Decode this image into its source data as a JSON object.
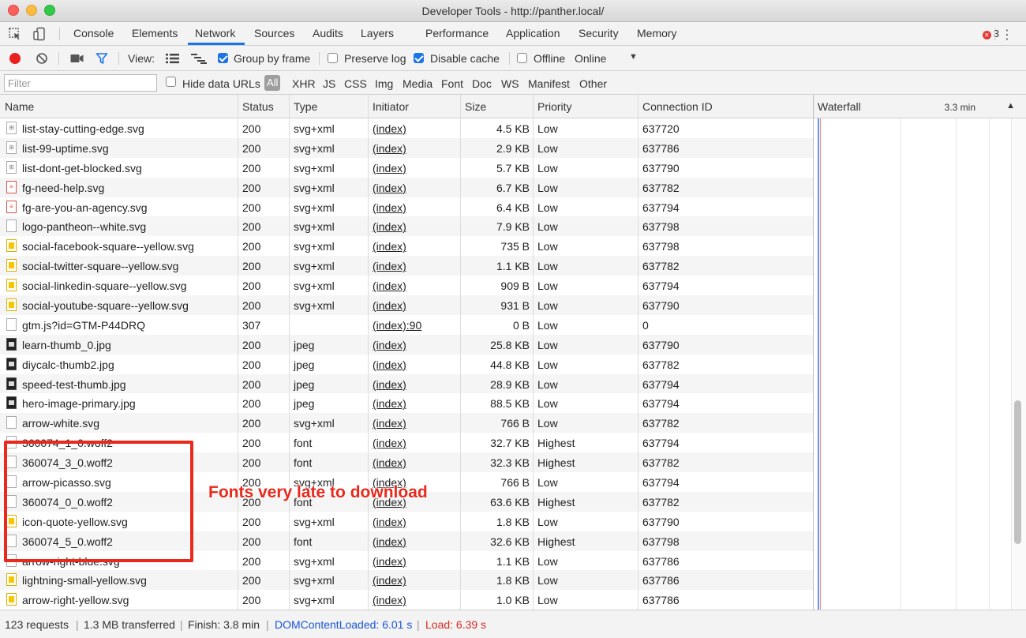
{
  "window": {
    "title": "Developer Tools - http://panther.local/"
  },
  "tabs": [
    {
      "label": "Console"
    },
    {
      "label": "Elements"
    },
    {
      "label": "Network"
    },
    {
      "label": "Sources"
    },
    {
      "label": "Audits"
    },
    {
      "label": "Layers"
    },
    {
      "label": "Performance"
    },
    {
      "label": "Application"
    },
    {
      "label": "Security"
    },
    {
      "label": "Memory"
    }
  ],
  "error_count": "3",
  "toolbar": {
    "view_label": "View:",
    "group_by_frame": "Group by frame",
    "preserve_log": "Preserve log",
    "disable_cache": "Disable cache",
    "offline": "Offline",
    "throttle": "Online"
  },
  "filterbar": {
    "filter_placeholder": "Filter",
    "hide_data_urls": "Hide data URLs",
    "all": "All",
    "types": [
      "XHR",
      "JS",
      "CSS",
      "Img",
      "Media",
      "Font",
      "Doc",
      "WS",
      "Manifest",
      "Other"
    ]
  },
  "columns": {
    "name": "Name",
    "status": "Status",
    "type": "Type",
    "initiator": "Initiator",
    "size": "Size",
    "priority": "Priority",
    "connection": "Connection ID",
    "waterfall": "Waterfall",
    "waterfall_time": "3.3 min"
  },
  "rows": [
    {
      "name": "list-stay-cutting-edge.svg",
      "status": "200",
      "type": "svg+xml",
      "initiator": "(index)",
      "size": "4.5 KB",
      "priority": "Low",
      "conn": "637720",
      "icon": "svg"
    },
    {
      "name": "list-99-uptime.svg",
      "status": "200",
      "type": "svg+xml",
      "initiator": "(index)",
      "size": "2.9 KB",
      "priority": "Low",
      "conn": "637786",
      "icon": "svg"
    },
    {
      "name": "list-dont-get-blocked.svg",
      "status": "200",
      "type": "svg+xml",
      "initiator": "(index)",
      "size": "5.7 KB",
      "priority": "Low",
      "conn": "637790",
      "icon": "svg"
    },
    {
      "name": "fg-need-help.svg",
      "status": "200",
      "type": "svg+xml",
      "initiator": "(index)",
      "size": "6.7 KB",
      "priority": "Low",
      "conn": "637782",
      "icon": "red"
    },
    {
      "name": "fg-are-you-an-agency.svg",
      "status": "200",
      "type": "svg+xml",
      "initiator": "(index)",
      "size": "6.4 KB",
      "priority": "Low",
      "conn": "637794",
      "icon": "red"
    },
    {
      "name": "logo-pantheon--white.svg",
      "status": "200",
      "type": "svg+xml",
      "initiator": "(index)",
      "size": "7.9 KB",
      "priority": "Low",
      "conn": "637798",
      "icon": "blank"
    },
    {
      "name": "social-facebook-square--yellow.svg",
      "status": "200",
      "type": "svg+xml",
      "initiator": "(index)",
      "size": "735 B",
      "priority": "Low",
      "conn": "637798",
      "icon": "yel"
    },
    {
      "name": "social-twitter-square--yellow.svg",
      "status": "200",
      "type": "svg+xml",
      "initiator": "(index)",
      "size": "1.1 KB",
      "priority": "Low",
      "conn": "637782",
      "icon": "yel"
    },
    {
      "name": "social-linkedin-square--yellow.svg",
      "status": "200",
      "type": "svg+xml",
      "initiator": "(index)",
      "size": "909 B",
      "priority": "Low",
      "conn": "637794",
      "icon": "yel"
    },
    {
      "name": "social-youtube-square--yellow.svg",
      "status": "200",
      "type": "svg+xml",
      "initiator": "(index)",
      "size": "931 B",
      "priority": "Low",
      "conn": "637790",
      "icon": "yel"
    },
    {
      "name": "gtm.js?id=GTM-P44DRQ",
      "status": "307",
      "type": "",
      "initiator": "(index):90",
      "size": "0 B",
      "priority": "Low",
      "conn": "0",
      "icon": "blank"
    },
    {
      "name": "learn-thumb_0.jpg",
      "status": "200",
      "type": "jpeg",
      "initiator": "(index)",
      "size": "25.8 KB",
      "priority": "Low",
      "conn": "637790",
      "icon": "img"
    },
    {
      "name": "diycalc-thumb2.jpg",
      "status": "200",
      "type": "jpeg",
      "initiator": "(index)",
      "size": "44.8 KB",
      "priority": "Low",
      "conn": "637782",
      "icon": "img"
    },
    {
      "name": "speed-test-thumb.jpg",
      "status": "200",
      "type": "jpeg",
      "initiator": "(index)",
      "size": "28.9 KB",
      "priority": "Low",
      "conn": "637794",
      "icon": "img"
    },
    {
      "name": "hero-image-primary.jpg",
      "status": "200",
      "type": "jpeg",
      "initiator": "(index)",
      "size": "88.5 KB",
      "priority": "Low",
      "conn": "637794",
      "icon": "img"
    },
    {
      "name": "arrow-white.svg",
      "status": "200",
      "type": "svg+xml",
      "initiator": "(index)",
      "size": "766 B",
      "priority": "Low",
      "conn": "637782",
      "icon": "blank"
    },
    {
      "name": "360074_1_0.woff2",
      "status": "200",
      "type": "font",
      "initiator": "(index)",
      "size": "32.7 KB",
      "priority": "Highest",
      "conn": "637794",
      "icon": "blank"
    },
    {
      "name": "360074_3_0.woff2",
      "status": "200",
      "type": "font",
      "initiator": "(index)",
      "size": "32.3 KB",
      "priority": "Highest",
      "conn": "637782",
      "icon": "blank"
    },
    {
      "name": "arrow-picasso.svg",
      "status": "200",
      "type": "svg+xml",
      "initiator": "(index)",
      "size": "766 B",
      "priority": "Low",
      "conn": "637794",
      "icon": "blank"
    },
    {
      "name": "360074_0_0.woff2",
      "status": "200",
      "type": "font",
      "initiator": "(index)",
      "size": "63.6 KB",
      "priority": "Highest",
      "conn": "637782",
      "icon": "blank"
    },
    {
      "name": "icon-quote-yellow.svg",
      "status": "200",
      "type": "svg+xml",
      "initiator": "(index)",
      "size": "1.8 KB",
      "priority": "Low",
      "conn": "637790",
      "icon": "yel"
    },
    {
      "name": "360074_5_0.woff2",
      "status": "200",
      "type": "font",
      "initiator": "(index)",
      "size": "32.6 KB",
      "priority": "Highest",
      "conn": "637798",
      "icon": "blank"
    },
    {
      "name": "arrow-right-blue.svg",
      "status": "200",
      "type": "svg+xml",
      "initiator": "(index)",
      "size": "1.1 KB",
      "priority": "Low",
      "conn": "637786",
      "icon": "blue"
    },
    {
      "name": "lightning-small-yellow.svg",
      "status": "200",
      "type": "svg+xml",
      "initiator": "(index)",
      "size": "1.8 KB",
      "priority": "Low",
      "conn": "637786",
      "icon": "yel"
    },
    {
      "name": "arrow-right-yellow.svg",
      "status": "200",
      "type": "svg+xml",
      "initiator": "(index)",
      "size": "1.0 KB",
      "priority": "Low",
      "conn": "637786",
      "icon": "yel"
    }
  ],
  "annotation": {
    "text": "Fonts very late to download",
    "color": "#e8291c"
  },
  "statusbar": {
    "requests": "123 requests",
    "transferred": "1.3 MB transferred",
    "finish": "Finish: 3.8 min",
    "dcl": "DOMContentLoaded: 6.01 s",
    "load": "Load: 6.39 s"
  },
  "colors": {
    "accent": "#1a73e8",
    "record": "#e8211e",
    "dcl": "#1a56d8",
    "load": "#d72b20"
  }
}
